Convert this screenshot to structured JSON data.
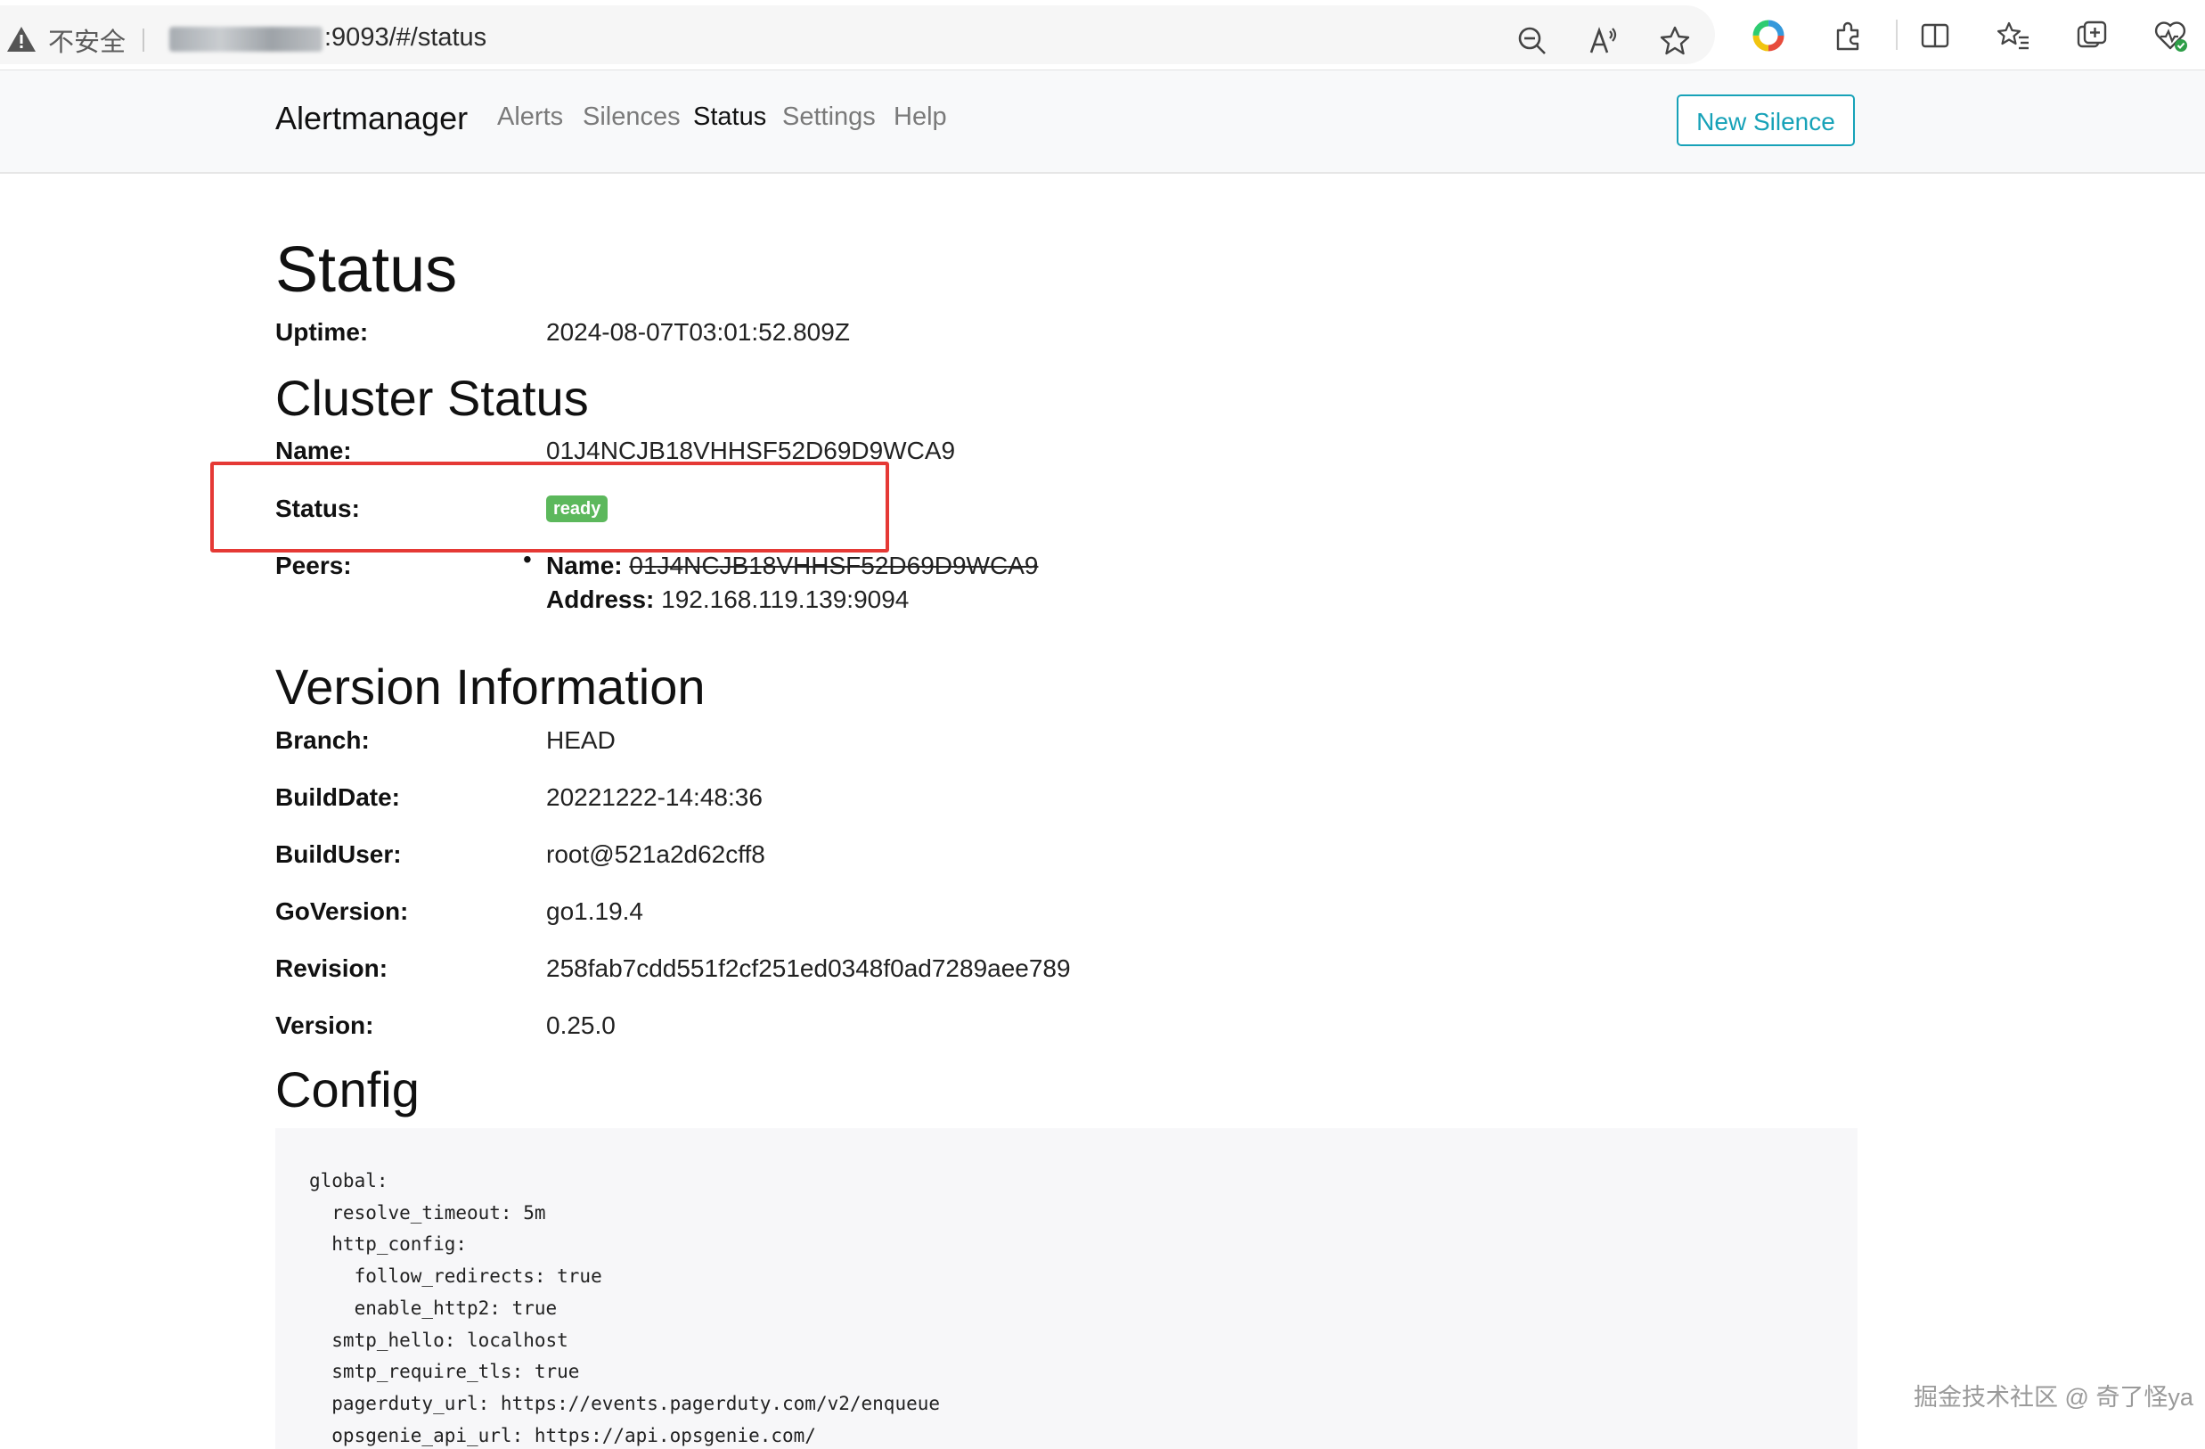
{
  "browser": {
    "security_label": "不安全",
    "url": ":9093/#/status",
    "icons": [
      "warning-icon",
      "zoom-out-icon",
      "read-aloud-icon",
      "favorite-star-icon",
      "copilot-icon",
      "extensions-icon",
      "split-screen-icon",
      "favorites-list-icon",
      "collections-icon",
      "browser-health-icon"
    ]
  },
  "navbar": {
    "brand": "Alertmanager",
    "links": [
      "Alerts",
      "Silences",
      "Status",
      "Settings",
      "Help"
    ],
    "active": "Status",
    "new_silence": "New Silence"
  },
  "page": {
    "title": "Status",
    "uptime_label": "Uptime:",
    "uptime_value": "2024-08-07T03:01:52.809Z"
  },
  "cluster": {
    "title": "Cluster Status",
    "name_label": "Name:",
    "name_value": "01J4NCJB18VHHSF52D69D9WCA9",
    "status_label": "Status:",
    "status_badge": "ready",
    "peers_label": "Peers:",
    "peer_name_label": "Name:",
    "peer_name_value": "01J4NCJB18VHHSF52D69D9WCA9",
    "peer_address_label": "Address:",
    "peer_address_value": "192.168.119.139:9094"
  },
  "version": {
    "title": "Version Information",
    "rows": [
      {
        "label": "Branch:",
        "value": "HEAD"
      },
      {
        "label": "BuildDate:",
        "value": "20221222-14:48:36"
      },
      {
        "label": "BuildUser:",
        "value": "root@521a2d62cff8"
      },
      {
        "label": "GoVersion:",
        "value": "go1.19.4"
      },
      {
        "label": "Revision:",
        "value": "258fab7cdd551f2cf251ed0348f0ad7289aee789"
      },
      {
        "label": "Version:",
        "value": "0.25.0"
      }
    ]
  },
  "config": {
    "title": "Config",
    "text": "global:\n  resolve_timeout: 5m\n  http_config:\n    follow_redirects: true\n    enable_http2: true\n  smtp_hello: localhost\n  smtp_require_tls: true\n  pagerduty_url: https://events.pagerduty.com/v2/enqueue\n  opsgenie_api_url: https://api.opsgenie.com/"
  },
  "watermark": "掘金技术社区 @ 奇了怪ya",
  "colors": {
    "accent": "#17a2b8",
    "badge_success": "#5cb85c",
    "highlight": "#e53935"
  }
}
